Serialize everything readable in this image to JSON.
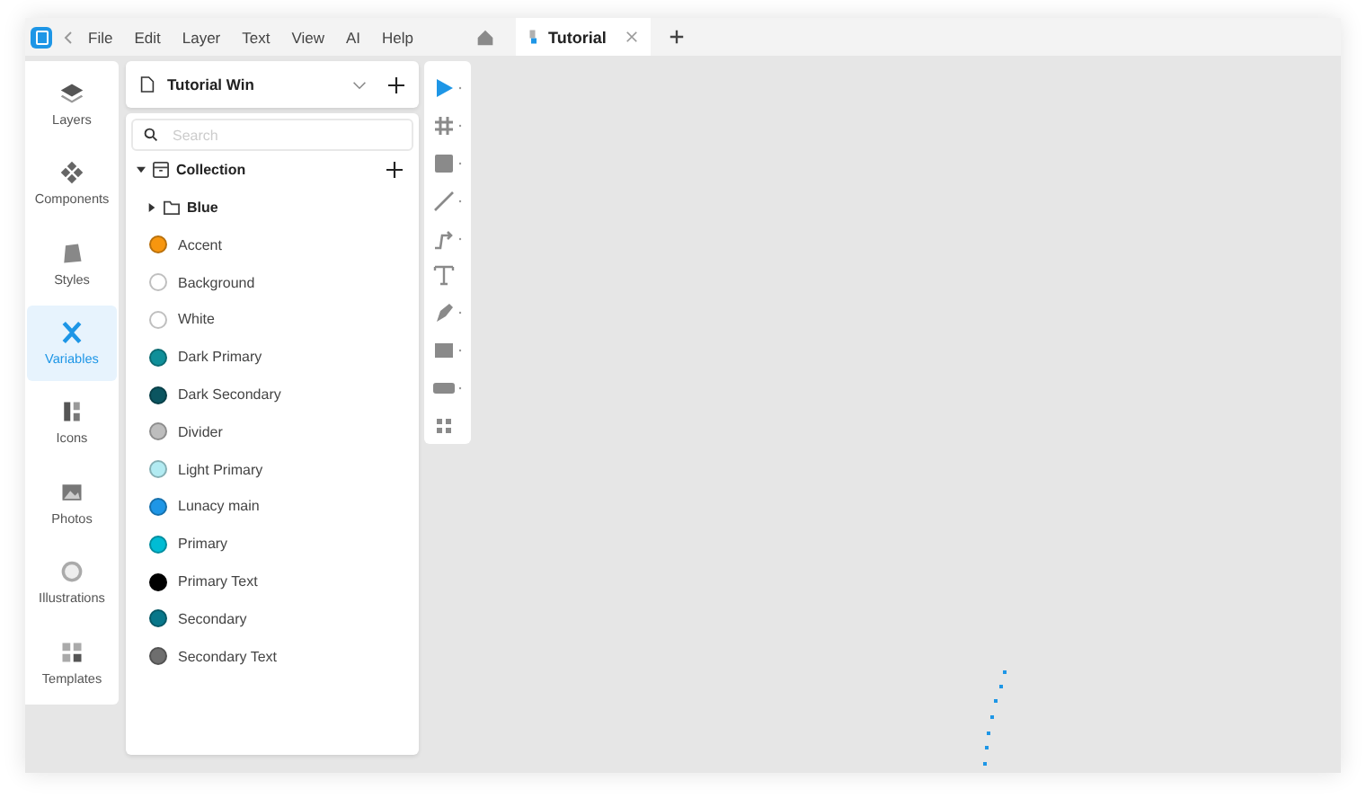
{
  "menu": [
    "File",
    "Edit",
    "Layer",
    "Text",
    "View",
    "AI",
    "Help"
  ],
  "tabs": [
    {
      "label": "Tutorial",
      "selected": true
    }
  ],
  "nav": [
    {
      "label": "Layers",
      "selected": false
    },
    {
      "label": "Components",
      "selected": false
    },
    {
      "label": "Styles",
      "selected": false
    },
    {
      "label": "Variables",
      "selected": true
    },
    {
      "label": "Icons",
      "selected": false
    },
    {
      "label": "Photos",
      "selected": false
    },
    {
      "label": "Illustrations",
      "selected": false
    },
    {
      "label": "Templates",
      "selected": false
    }
  ],
  "document": {
    "title": "Tutorial Win"
  },
  "search": {
    "placeholder": "Search"
  },
  "collection": {
    "label": "Collection",
    "expanded": true,
    "group": {
      "label": "Blue",
      "expanded": false
    },
    "variables": [
      {
        "name": "Accent",
        "color": "#f7960f"
      },
      {
        "name": "Background",
        "color": "#ffffff"
      },
      {
        "name": "White",
        "color": "#ffffff"
      },
      {
        "name": "Dark Primary",
        "color": "#0f8f99"
      },
      {
        "name": "Dark Secondary",
        "color": "#0b5560"
      },
      {
        "name": "Divider",
        "color": "#bdbdbd"
      },
      {
        "name": "Light Primary",
        "color": "#b2ebf2"
      },
      {
        "name": "Lunacy main",
        "color": "#1e96e6"
      },
      {
        "name": "Primary",
        "color": "#00bcd4"
      },
      {
        "name": "Primary Text",
        "color": "#000000"
      },
      {
        "name": "Secondary",
        "color": "#08778a"
      },
      {
        "name": "Secondary Text",
        "color": "#6e6e6e"
      }
    ]
  },
  "tools": [
    {
      "kind": "pointer",
      "selected": true
    },
    {
      "kind": "frame",
      "selected": false
    },
    {
      "kind": "rectangle",
      "selected": false
    },
    {
      "kind": "line",
      "selected": false
    },
    {
      "kind": "connector",
      "selected": false
    },
    {
      "kind": "text",
      "selected": false
    },
    {
      "kind": "pen",
      "selected": false
    },
    {
      "kind": "image",
      "selected": false
    },
    {
      "kind": "component",
      "selected": false
    },
    {
      "kind": "plugin",
      "selected": false
    }
  ]
}
